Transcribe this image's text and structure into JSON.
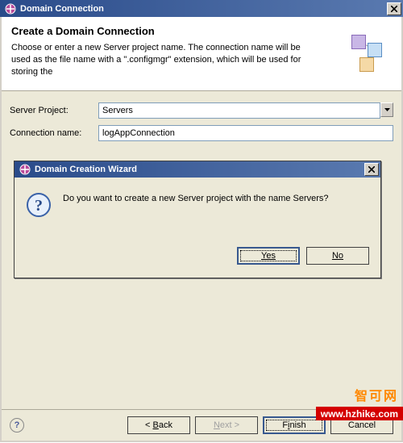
{
  "window": {
    "title": "Domain Connection"
  },
  "header": {
    "heading": "Create a Domain Connection",
    "description": "Choose or enter a new Server project name. The connection name will be used as the file name with a \".configmgr\" extension, which will be used for storing the"
  },
  "form": {
    "server_project_label": "Server Project:",
    "server_project_value": "Servers",
    "connection_name_label": "Connection name:",
    "connection_name_value": "logAppConnection"
  },
  "inner_dialog": {
    "title": "Domain Creation Wizard",
    "message": "Do you want to create a new Server project with the name Servers?",
    "yes_label": "Yes",
    "no_label": "No"
  },
  "footer": {
    "back_label": "< Back",
    "next_label": "Next >",
    "finish_label": "Finish",
    "cancel_label": "Cancel"
  },
  "watermark": {
    "cn": "智可网",
    "url": "www.hzhike.com"
  }
}
